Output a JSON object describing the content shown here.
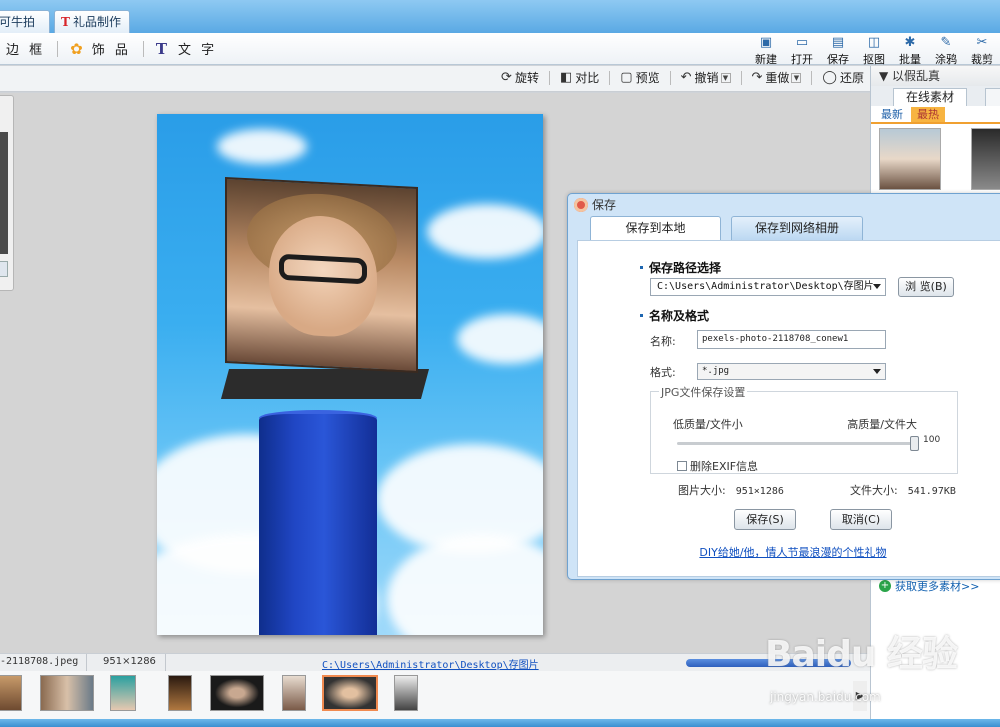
{
  "tabs": [
    {
      "label": "可牛拍照"
    },
    {
      "label": "礼品制作",
      "icon": "t-logo-icon"
    }
  ],
  "toolbar": {
    "left_items": [
      {
        "label": "边 框"
      },
      {
        "label": "饰 品",
        "icon": "flower-icon"
      },
      {
        "label": "文 字",
        "icon": "text-t-icon"
      }
    ],
    "right_items": [
      {
        "label": "新建",
        "icon": "new-icon"
      },
      {
        "label": "打开",
        "icon": "folder-open-icon"
      },
      {
        "label": "保存",
        "icon": "save-icon"
      },
      {
        "label": "抠图",
        "icon": "cutout-icon"
      },
      {
        "label": "批量",
        "icon": "batch-icon"
      },
      {
        "label": "涂鸦",
        "icon": "doodle-icon"
      },
      {
        "label": "裁剪",
        "icon": "crop-icon"
      }
    ]
  },
  "subbar": {
    "rotate": "旋转",
    "compare": "对比",
    "preview": "预览",
    "undo": "撤销",
    "redo": "重做",
    "restore": "还原"
  },
  "right_panel": {
    "title": "以假乱真",
    "tab_online": "在线素材",
    "sub_latest": "最新",
    "sub_hot": "最热",
    "more_link": "获取更多素材>>"
  },
  "dialog": {
    "title": "保存",
    "tab_local": "保存到本地",
    "tab_album": "保存到网络相册",
    "section_path": "保存路径选择",
    "path_value": "C:\\Users\\Administrator\\Desktop\\存图片",
    "browse_label": "浏 览(B)",
    "section_name_format": "名称及格式",
    "name_label": "名称:",
    "name_value": "pexels-photo-2118708_conew1",
    "format_label": "格式:",
    "format_value": "*.jpg",
    "jpg_settings_legend": "JPG文件保存设置",
    "quality_low": "低质量/文件小",
    "quality_high": "高质量/文件大",
    "quality_value": "100",
    "quality_fraction": 1.0,
    "exif_label": "删除EXIF信息",
    "exif_checked": false,
    "image_size_label": "图片大小:",
    "image_size_value": "951×1286",
    "file_size_label": "文件大小:",
    "file_size_value": "541.97KB",
    "save_button": "保存(S)",
    "cancel_button": "取消(C)",
    "promo_link": "DIY给她/他，情人节最浪漫的个性礼物"
  },
  "statusbar": {
    "filename": "-2118708.jpeg",
    "dimensions": "951×1286",
    "path": "C:\\Users\\Administrator\\Desktop\\存图片"
  },
  "filmstrip": {
    "count": 8,
    "selected_index": 6
  },
  "watermark": {
    "brand": "Baidu 经验",
    "url": "jingyan.baidu.com"
  },
  "colors": {
    "accent_blue": "#5aa9e4",
    "link_blue": "#1050c0",
    "hot_tab": "#f7b441"
  }
}
